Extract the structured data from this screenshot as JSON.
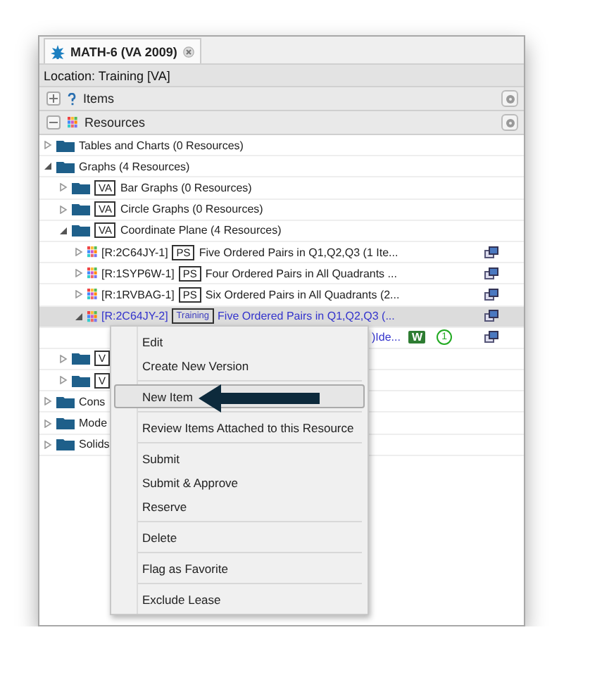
{
  "tab": {
    "title": "MATH-6 (VA 2009)"
  },
  "location": "Location: Training [VA]",
  "sections": [
    {
      "label": "Items",
      "expanded": false,
      "kind": "items"
    },
    {
      "label": "Resources",
      "expanded": true,
      "kind": "resources"
    }
  ],
  "tree": [
    {
      "kind": "folder",
      "label": "Tables and Charts (0 Resources)",
      "expanded": false
    },
    {
      "kind": "folder",
      "label": "Graphs (4 Resources)",
      "expanded": true,
      "children": [
        {
          "kind": "folder",
          "badge": "VA",
          "label": "Bar Graphs (0 Resources)",
          "expanded": false
        },
        {
          "kind": "folder",
          "badge": "VA",
          "label": "Circle Graphs (0 Resources)",
          "expanded": false
        },
        {
          "kind": "folder",
          "badge": "VA",
          "label": "Coordinate Plane (4 Resources)",
          "expanded": true,
          "children": [
            {
              "kind": "resource",
              "id": "[R:2C64JY-1]",
              "badge": "PS",
              "label": "Five Ordered Pairs in Q1,Q2,Q3 (1 Ite...",
              "expanded": false,
              "selected": false
            },
            {
              "kind": "resource",
              "id": "[R:1SYP6W-1]",
              "badge": "PS",
              "label": "Four Ordered Pairs in All Quadrants ...",
              "expanded": false,
              "selected": false
            },
            {
              "kind": "resource",
              "id": "[R:1RVBAG-1]",
              "badge": "PS",
              "label": "Six Ordered Pairs in All Quadrants (2...",
              "expanded": false,
              "selected": false
            },
            {
              "kind": "resource",
              "id": "[R:2C64JY-2]",
              "badge": "Training",
              "label": "Five Ordered Pairs in Q1,Q2,Q3 (...",
              "expanded": true,
              "selected": true,
              "children": [
                {
                  "kind": "covered",
                  "label": ")Ide...",
                  "status": "W",
                  "count": "1"
                }
              ]
            }
          ]
        },
        {
          "kind": "folder",
          "badge": "V",
          "expanded": false
        },
        {
          "kind": "folder",
          "badge": "V",
          "expanded": false
        }
      ]
    },
    {
      "kind": "folder",
      "label": "Cons",
      "expanded": false
    },
    {
      "kind": "folder",
      "label": "Mode",
      "expanded": false
    },
    {
      "kind": "folder",
      "label": "Solids",
      "expanded": false
    }
  ],
  "menu": {
    "groups": [
      [
        {
          "label": "Edit",
          "highlighted": false
        },
        {
          "label": "Create New Version",
          "highlighted": false
        }
      ],
      [
        {
          "label": "New Item",
          "highlighted": true
        }
      ],
      [
        {
          "label": "Review Items Attached to this Resource",
          "highlighted": false
        }
      ],
      [
        {
          "label": "Submit",
          "highlighted": false
        },
        {
          "label": "Submit & Approve",
          "highlighted": false
        },
        {
          "label": "Reserve",
          "highlighted": false
        }
      ],
      [
        {
          "label": "Delete",
          "highlighted": false
        }
      ],
      [
        {
          "label": "Flag as Favorite",
          "highlighted": false
        }
      ],
      [
        {
          "label": "Exclude Lease",
          "highlighted": false
        }
      ]
    ]
  }
}
